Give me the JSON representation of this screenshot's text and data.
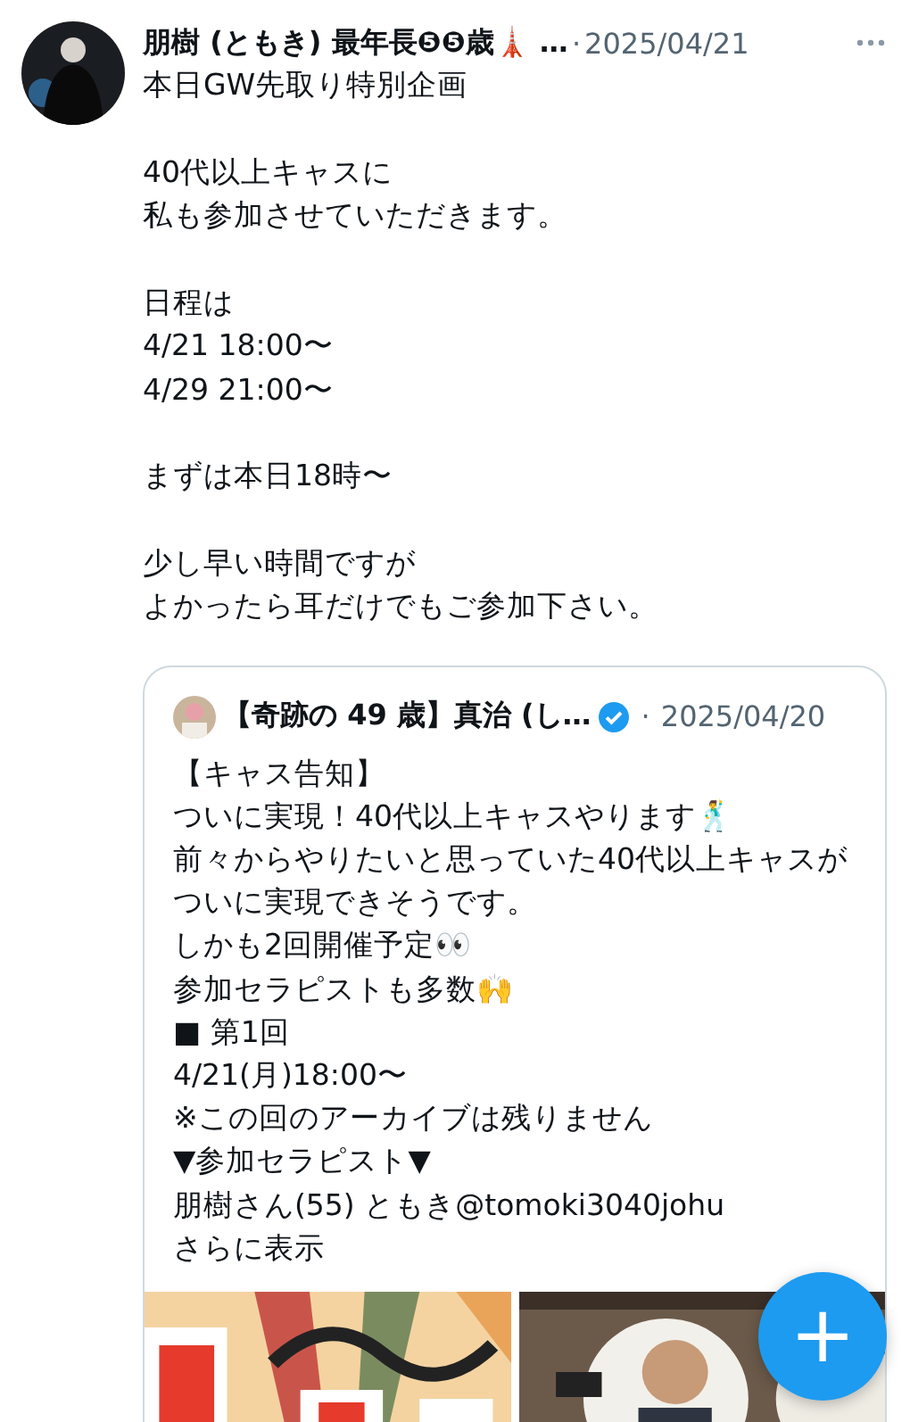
{
  "post": {
    "author": "朋樹 (ともき) 最年長❺❺歳🗼 …",
    "separator": "·",
    "date": "2025/04/21",
    "paragraphs": [
      [
        "本日GW先取り特別企画"
      ],
      [
        "40代以上キャスに",
        "私も参加させていただきます。"
      ],
      [
        "日程は",
        "4/21 18:00〜",
        "4/29 21:00〜"
      ],
      [
        "まずは本日18時〜"
      ],
      [
        "少し早い時間ですが",
        "よかったら耳だけでもご参加下さい。"
      ]
    ]
  },
  "quote": {
    "author": "【奇跡の 49 歳】真治 (し…",
    "verified": true,
    "separator": "·",
    "date": "2025/04/20",
    "lines": [
      "【キャス告知】",
      "ついに実現！40代以上キャスやります🕺",
      "前々からやりたいと思っていた40代以上キャスがついに実現できそうです。",
      "しかも2回開催予定👀",
      "参加セラピストも多数🙌",
      " ■ 第1回",
      "4/21(月)18:00〜",
      "※この回のアーカイブは残りません",
      "▼参加セラピスト▼",
      "朋樹さん(55) ともき@tomoki3040johu"
    ],
    "show_more": "さらに表示"
  },
  "compose_button": "+"
}
